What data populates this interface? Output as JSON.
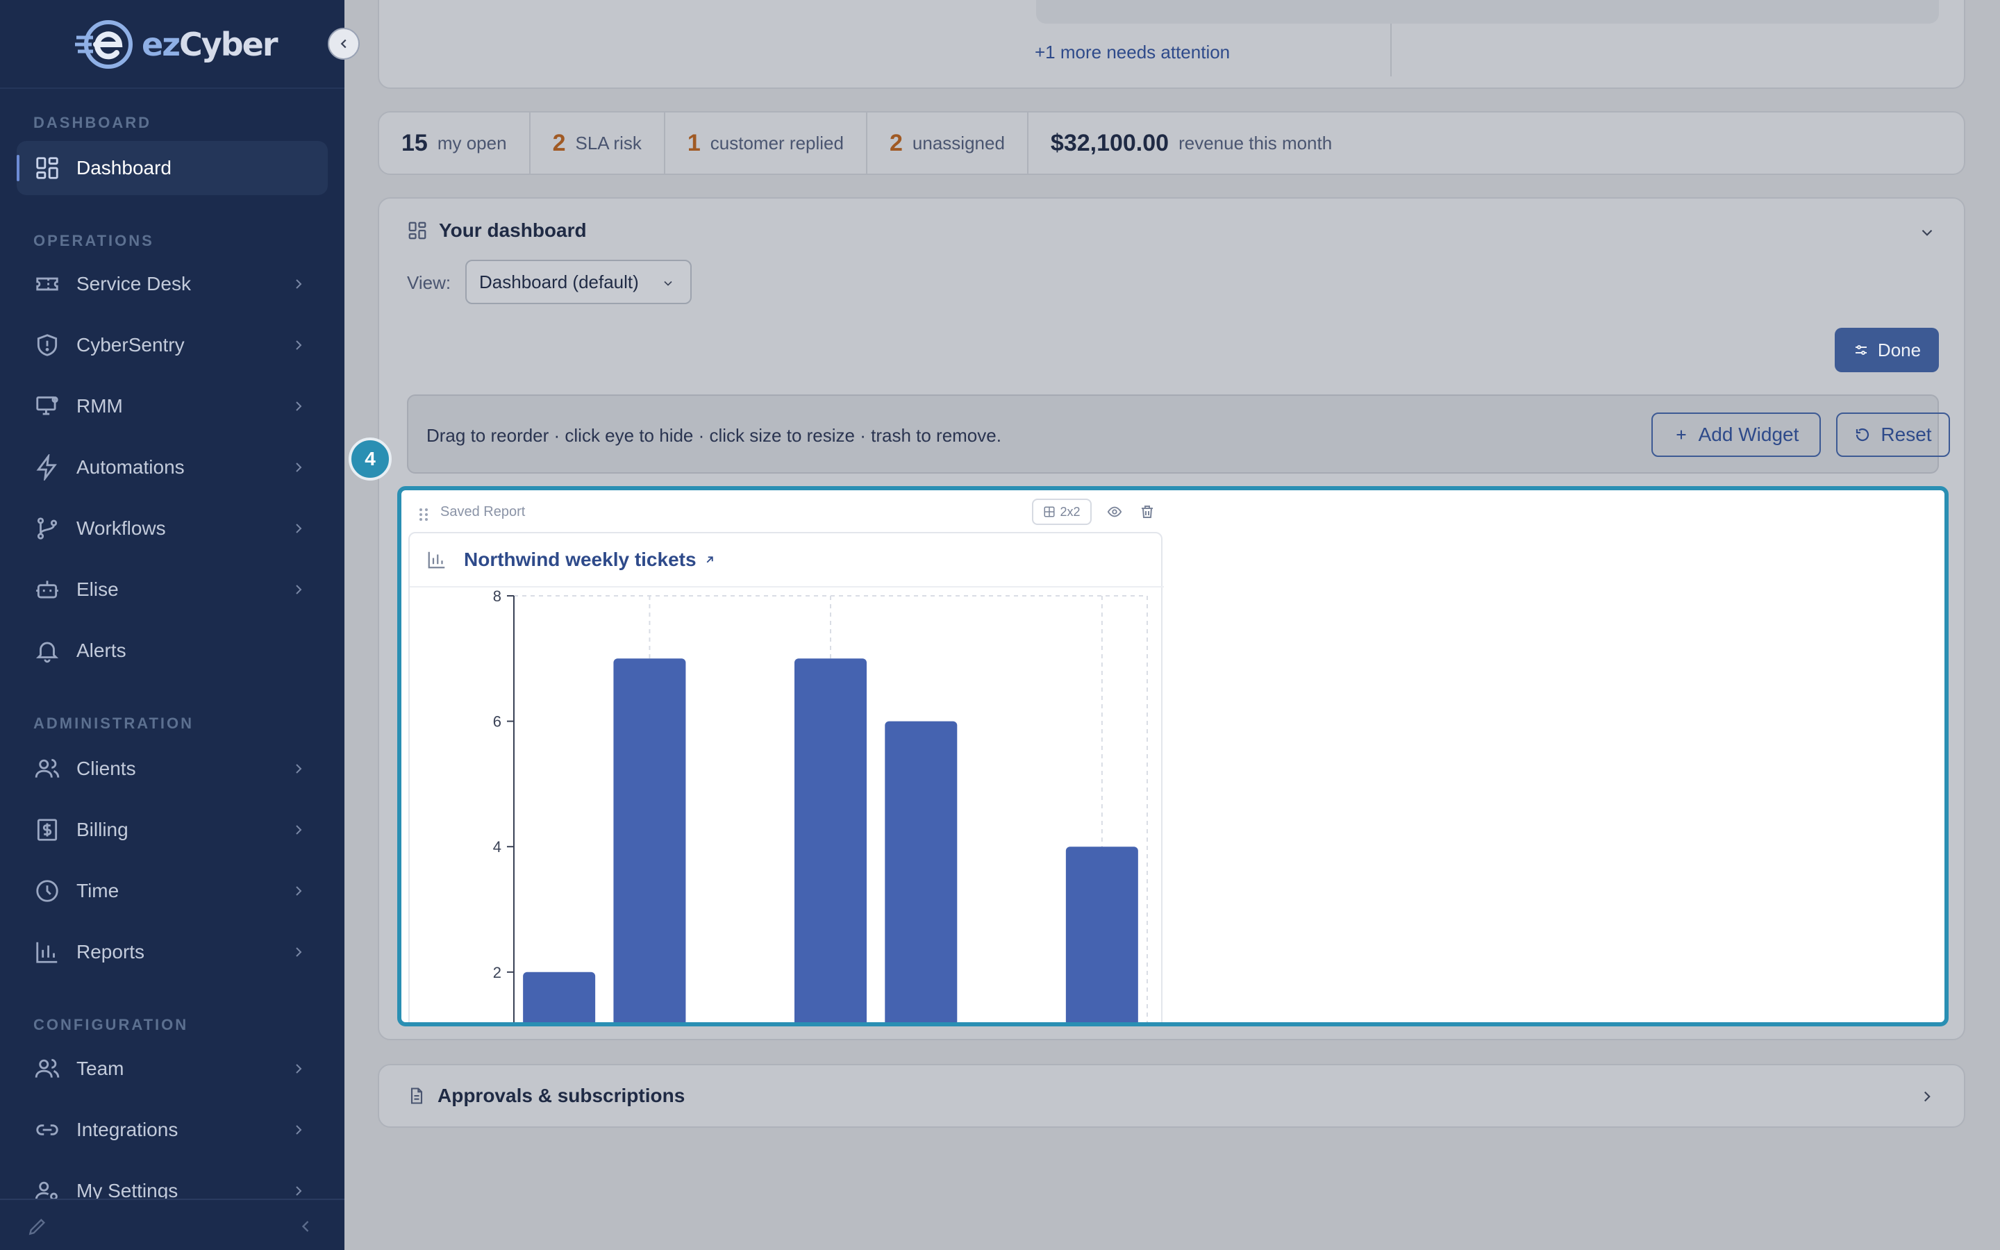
{
  "app": {
    "brand_prefix": "ez",
    "brand_suffix": "Cyber"
  },
  "sidebar": {
    "sections": {
      "dashboard": "DASHBOARD",
      "operations": "OPERATIONS",
      "administration": "ADMINISTRATION",
      "configuration": "CONFIGURATION"
    },
    "items": [
      {
        "label": "Dashboard",
        "icon": "grid-icon",
        "active": true
      },
      {
        "label": "Service Desk",
        "icon": "ticket-icon"
      },
      {
        "label": "CyberSentry",
        "icon": "shield-icon"
      },
      {
        "label": "RMM",
        "icon": "monitor-icon"
      },
      {
        "label": "Automations",
        "icon": "bolt-icon"
      },
      {
        "label": "Workflows",
        "icon": "branch-icon"
      },
      {
        "label": "Elise",
        "icon": "robot-icon"
      },
      {
        "label": "Alerts",
        "icon": "bell-icon"
      },
      {
        "label": "Clients",
        "icon": "users-icon"
      },
      {
        "label": "Billing",
        "icon": "dollar-icon"
      },
      {
        "label": "Time",
        "icon": "clock-icon"
      },
      {
        "label": "Reports",
        "icon": "bar-chart-icon"
      },
      {
        "label": "Team",
        "icon": "team-icon"
      },
      {
        "label": "Integrations",
        "icon": "link-icon"
      },
      {
        "label": "My Settings",
        "icon": "user-gear-icon"
      }
    ]
  },
  "top_card": {
    "more_link": "+1 more needs attention"
  },
  "stats": [
    {
      "num": "15",
      "label": "my open",
      "accent": false
    },
    {
      "num": "2",
      "label": "SLA risk",
      "accent": true
    },
    {
      "num": "1",
      "label": "customer replied",
      "accent": true
    },
    {
      "num": "2",
      "label": "unassigned",
      "accent": true
    },
    {
      "num": "$32,100.00",
      "label": "revenue this month",
      "accent": false
    }
  ],
  "dashboard": {
    "title": "Your dashboard",
    "view_label": "View:",
    "view_value": "Dashboard (default)",
    "done_label": "Done",
    "hint": "Drag to reorder · click eye to hide · click size to resize · trash to remove.",
    "add_widget_label": "Add Widget",
    "reset_label": "Reset",
    "step_number": "4"
  },
  "widget": {
    "type_label": "Saved Report",
    "size_label": "2x2",
    "report_title": "Northwind weekly tickets"
  },
  "chart_data": {
    "type": "bar",
    "values": [
      2,
      7,
      null,
      7,
      6,
      null,
      4
    ],
    "yticks": [
      2,
      4,
      6,
      8
    ],
    "ylim": [
      0,
      8
    ],
    "color": "#4563b0"
  },
  "approvals": {
    "title": "Approvals & subscriptions"
  },
  "colors": {
    "sidebar_bg": "#1b2b4d",
    "accent": "#3d5a94",
    "highlight": "#2a8fb3",
    "bar": "#4563b0"
  }
}
